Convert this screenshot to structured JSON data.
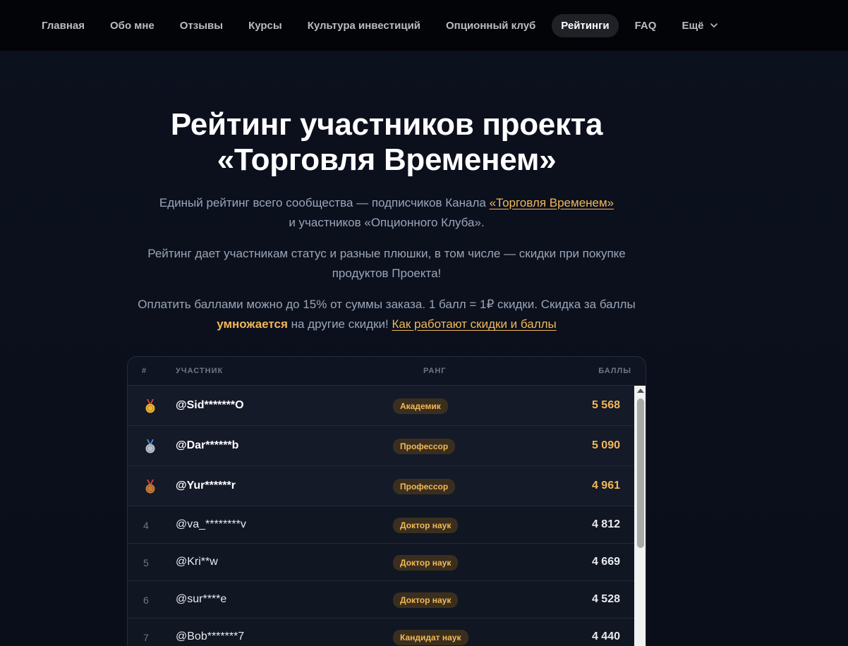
{
  "nav": {
    "items": [
      {
        "label": "Главная",
        "active": false
      },
      {
        "label": "Обо мне",
        "active": false
      },
      {
        "label": "Отзывы",
        "active": false
      },
      {
        "label": "Курсы",
        "active": false
      },
      {
        "label": "Культура инвестиций",
        "active": false
      },
      {
        "label": "Опционный клуб",
        "active": false
      },
      {
        "label": "Рейтинги",
        "active": true
      },
      {
        "label": "FAQ",
        "active": false
      }
    ],
    "more_label": "Ещё",
    "more_icon": "chevron-down-icon"
  },
  "hero": {
    "title_line1": "Рейтинг участников проекта",
    "title_line2": "«Торговля Временем»",
    "p1_before": "Единый рейтинг всего сообщества — подписчиков Канала ",
    "p1_link": "«Торговля Временем»",
    "p1_after": "и участников «Опционного Клуба».",
    "p2": "Рейтинг дает участникам статус и разные плюшки, в том числе — скидки при покупке продуктов Проекта!",
    "p3_before": "Оплатить баллами можно до 15% от суммы заказа. 1 балл = 1₽ скидки. Скидка за баллы ",
    "p3_accent": "умножается",
    "p3_middle": " на другие скидки! ",
    "p3_link": "Как работают скидки и баллы"
  },
  "table": {
    "headers": {
      "rank": "#",
      "member": "УЧАСТНИК",
      "tier": "РАНГ",
      "points": "БАЛЛЫ"
    },
    "rows": [
      {
        "rank": "1",
        "medal": "gold-medal-icon",
        "name": "@Sid*******O",
        "tier": "Академик",
        "points": "5 568"
      },
      {
        "rank": "2",
        "medal": "silver-medal-icon",
        "name": "@Dar******b",
        "tier": "Профессор",
        "points": "5 090"
      },
      {
        "rank": "3",
        "medal": "bronze-medal-icon",
        "name": "@Yur******r",
        "tier": "Профессор",
        "points": "4 961"
      },
      {
        "rank": "4",
        "medal": "",
        "name": "@va_********v",
        "tier": "Доктор наук",
        "points": "4 812"
      },
      {
        "rank": "5",
        "medal": "",
        "name": "@Kri**w",
        "tier": "Доктор наук",
        "points": "4 669"
      },
      {
        "rank": "6",
        "medal": "",
        "name": "@sur****e",
        "tier": "Доктор наук",
        "points": "4 528"
      },
      {
        "rank": "7",
        "medal": "",
        "name": "@Bob*******7",
        "tier": "Кандидат наук",
        "points": "4 440"
      }
    ]
  },
  "colors": {
    "accent": "#f3b857",
    "gold": "#f0b232",
    "silver": "#b9c2cc",
    "bronze": "#c57a3a",
    "ribbon_red": "#d9483b",
    "ribbon_blue": "#4a8fd6"
  }
}
